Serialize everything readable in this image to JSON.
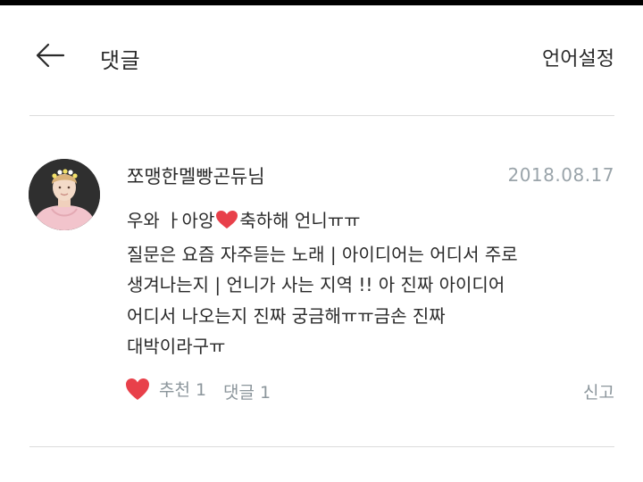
{
  "header": {
    "title": "댓글",
    "language_setting": "언어설정"
  },
  "comment": {
    "author": "쪼맹한멜빵곤듀님",
    "date": "2018.08.17",
    "lines": [
      {
        "before": "우와 ㅏ아앙",
        "emoji": "heart",
        "after": "축하해 언니ㅠㅠ"
      },
      {
        "text": "질문은 요즘 자주듣는 노래 | 아이디어는 어디서 주로"
      },
      {
        "text": "생겨나는지 | 언니가 사는 지역 !! 아 진짜 아이디어"
      },
      {
        "text": "어디서 나오는지 진짜 궁금해ㅠㅠ금손 진짜"
      },
      {
        "text": "대박이라구ㅠ"
      }
    ],
    "like_label": "추천 1",
    "reply_label": "댓글 1",
    "report_label": "신고"
  },
  "colors": {
    "heart": "#e8404a",
    "muted_text": "#8c969c",
    "date_text": "#9aa4aa",
    "divider": "#dcdcdc"
  }
}
